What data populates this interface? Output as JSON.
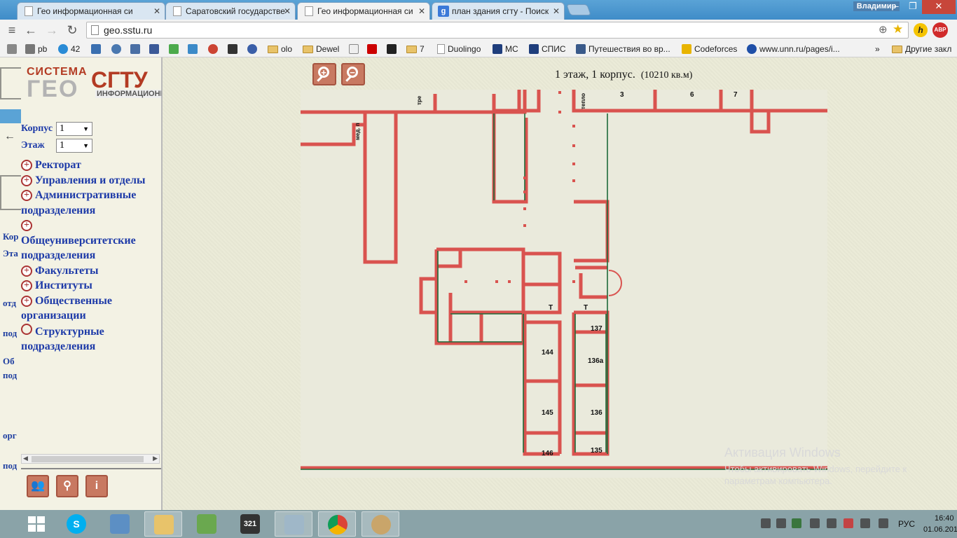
{
  "browser": {
    "tabs": [
      {
        "title": "Гео информационная си",
        "active": false
      },
      {
        "title": "Саратовский государстве",
        "active": false
      },
      {
        "title": "Гео информационная си",
        "active": true
      },
      {
        "title": "план здания сгту - Поиск",
        "active": false
      }
    ],
    "user_name": "Владимир",
    "url": "geo.sstu.ru",
    "bookmarks": [
      {
        "label": "pb",
        "icon": "grid-icon"
      },
      {
        "label": "42",
        "icon": "badge-icon"
      },
      {
        "label": "",
        "icon": "h-icon"
      },
      {
        "label": "",
        "icon": "vk-icon"
      },
      {
        "label": "",
        "icon": "vk-icon"
      },
      {
        "label": "",
        "icon": "facebook-icon"
      },
      {
        "label": "",
        "icon": "app-icon"
      },
      {
        "label": "",
        "icon": "app-icon"
      },
      {
        "label": "",
        "icon": "app-icon"
      },
      {
        "label": "",
        "icon": "app-icon"
      },
      {
        "label": "",
        "icon": "app-icon"
      },
      {
        "label": "olo",
        "icon": "folder-icon"
      },
      {
        "label": "Dewel",
        "icon": "folder-icon"
      },
      {
        "label": "",
        "icon": "app-icon"
      },
      {
        "label": "",
        "icon": "youtube-icon"
      },
      {
        "label": "",
        "icon": "app-icon"
      },
      {
        "label": "7",
        "icon": "folder-icon"
      },
      {
        "label": "Duolingo",
        "icon": "page-icon"
      },
      {
        "label": "MC",
        "icon": "app-icon"
      },
      {
        "label": "СПИС",
        "icon": "app-icon"
      },
      {
        "label": "Путешествия во вр...",
        "icon": "app-icon"
      },
      {
        "label": "Codeforces",
        "icon": "app-icon"
      },
      {
        "label": "www.unn.ru/pages/i...",
        "icon": "app-icon"
      },
      {
        "label": "»",
        "icon": ""
      },
      {
        "label": "Другие закл",
        "icon": "folder-icon"
      }
    ]
  },
  "left": {
    "logo": {
      "line1": "СИСТЕМА",
      "line2": "ГЕО",
      "line3": "СГТУ",
      "line4": "ИНФОРМАЦИОНН"
    },
    "building_label": "Корпус",
    "building_value": "1",
    "floor_label": "Этаж",
    "floor_value": "1",
    "ghost_texts": [
      "Кор",
      "Эта",
      "отд",
      "под",
      "Об",
      "под",
      "орг",
      "под"
    ],
    "tree": [
      {
        "label": "Ректорат",
        "expandable": true
      },
      {
        "label": "Управления и отделы",
        "expandable": true
      },
      {
        "label": "Административные подразделения",
        "expandable": true
      },
      {
        "label": "Общеуниверситетские подразделения",
        "expandable": true
      },
      {
        "label": "Факультеты",
        "expandable": true
      },
      {
        "label": "Институты",
        "expandable": true
      },
      {
        "label": "Общественные организации",
        "expandable": true
      },
      {
        "label": "Структурные подразделения",
        "expandable": false
      }
    ],
    "tools": [
      "people-icon",
      "search-icon",
      "info-icon"
    ]
  },
  "map": {
    "title": "1 этаж, 1 корпус.",
    "area": "(10210 кв.м)",
    "room_labels": [
      "3",
      "6",
      "7",
      "тепло",
      "мед. п",
      "тре",
      "Т",
      "Т",
      "137",
      "144",
      "136а",
      "145",
      "136",
      "146",
      "135"
    ]
  },
  "activation": {
    "title": "Активация Windows",
    "text": "Чтобы активировать Windows, перейдите к параметрам компьютера."
  },
  "taskbar": {
    "apps": [
      "skype",
      "control-panel",
      "explorer",
      "notepad",
      "media-player",
      "monitor",
      "chrome",
      "paint"
    ],
    "language": "РУС",
    "time": "16:40",
    "date": "01.06.201"
  }
}
